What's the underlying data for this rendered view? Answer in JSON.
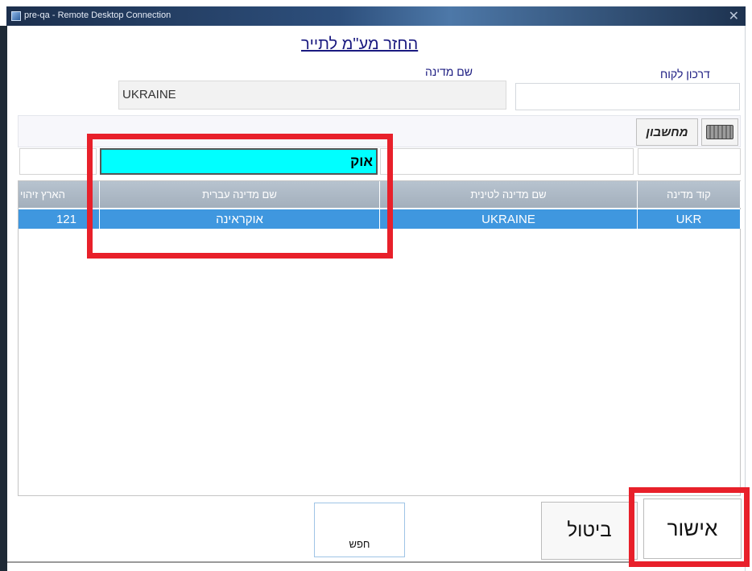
{
  "window": {
    "title": "pre-qa - Remote Desktop Connection"
  },
  "dialog": {
    "title": "החזר מע\"מ לתייר",
    "customer_code_label": "דרכון לקוח",
    "country_name_label": "שם מדינה",
    "customer_code_value": "",
    "country_name_value": "UKRAINE"
  },
  "toolbar": {
    "keyboard_icon": "keyboard-icon",
    "calculator_label": "מחשבון"
  },
  "filter": {
    "code": "",
    "latin_name": "",
    "hebrew_name": "אוק",
    "id": ""
  },
  "grid": {
    "columns": [
      "קוד מדינה",
      "שם מדינה לטינית",
      "שם מדינה עברית",
      "הארץ זיהוי"
    ],
    "rows": [
      {
        "code": "UKR",
        "latin_name": "UKRAINE",
        "hebrew_name": "אוקראינה",
        "id": "121",
        "selected": true
      }
    ]
  },
  "buttons": {
    "search": "חפש",
    "cancel": "ביטול",
    "ok": "אישור"
  },
  "colors": {
    "selected_row": "#3f97df",
    "filter_highlight": "#00ffff",
    "annotation_red": "#e8202a",
    "header_bg": "#aab6c3",
    "title_text": "#1a1a80"
  }
}
